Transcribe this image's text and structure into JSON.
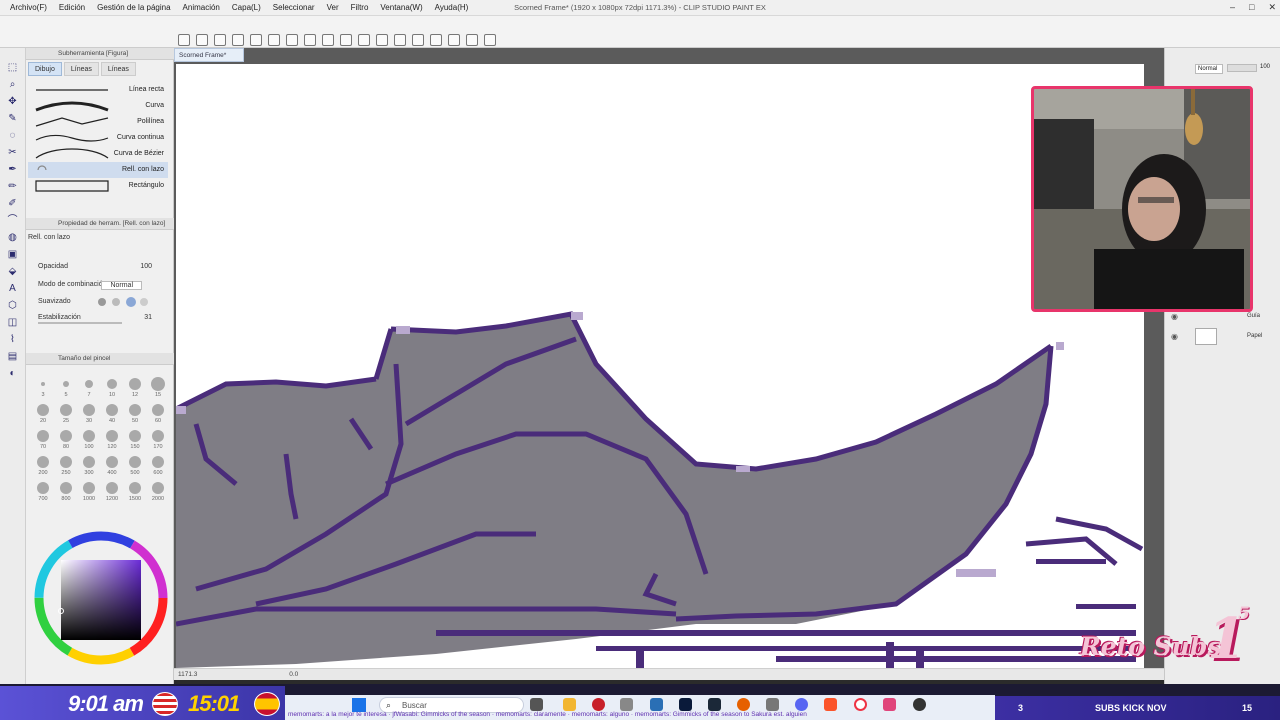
{
  "menu": [
    "Archivo(F)",
    "Edición",
    "Gestión de la página",
    "Animación",
    "Capa(L)",
    "Seleccionar",
    "Ver",
    "Filtro",
    "Ventana(W)",
    "Ayuda(H)"
  ],
  "window_title": "Scorned Frame* (1920 x 1080px 72dpi 1171.3%) - CLIP STUDIO PAINT EX",
  "doc_tab": "Scorned Frame*",
  "subtool": {
    "header": "Subherramienta [Figura]",
    "tabs": [
      "Dibujo",
      "Líneas",
      "Líneas"
    ],
    "items": [
      "Línea recta",
      "Curva",
      "Polilínea",
      "Curva continua",
      "Curva de Bézier",
      "Rell. con lazo",
      "Rectángulo"
    ]
  },
  "tool_property": {
    "header": "Propiedad de herram. [Rell. con lazo]",
    "name": "Rell. con lazo",
    "opacity_label": "Opacidad",
    "opacity_value": "100",
    "blend_label": "Modo de combinación",
    "blend_value": "Normal",
    "smoothing_label": "Suavizado",
    "stabilization_label": "Estabilización",
    "stabilization_value": "31"
  },
  "brush_size": {
    "header": "Tamaño del pincel",
    "sizes": [
      [
        "3",
        "5",
        "7",
        "10",
        "12",
        "15"
      ],
      [
        "20",
        "25",
        "30",
        "40",
        "50",
        "60"
      ],
      [
        "70",
        "80",
        "100",
        "120",
        "150",
        "170"
      ],
      [
        "200",
        "250",
        "300",
        "400",
        "500",
        "600"
      ],
      [
        "700",
        "800",
        "1000",
        "1200",
        "1500",
        "2000"
      ]
    ]
  },
  "status": {
    "zoom": "1171.3",
    "angle": "0.0"
  },
  "layers": {
    "blend_mode": "Normal",
    "opacity": "100",
    "names": [
      "Guía",
      "Papel"
    ]
  },
  "stream": {
    "clock_local": "9:01 am",
    "clock_spain": "15:01",
    "search_label": "Buscar",
    "ticker": "memomarts: a la mejor te interesa · jfWasabi: Gimmicks of the season · memomarts: claramente · memomarts: alguno · memomarts: Gimmicks of the season to Sakura est. alguien",
    "subs_goal_label": "SUBS KICK NOV",
    "subs_left": "3",
    "subs_right": "15",
    "reto_text": "Reto Subs",
    "reto_number": "1",
    "reto_sup": "5"
  }
}
